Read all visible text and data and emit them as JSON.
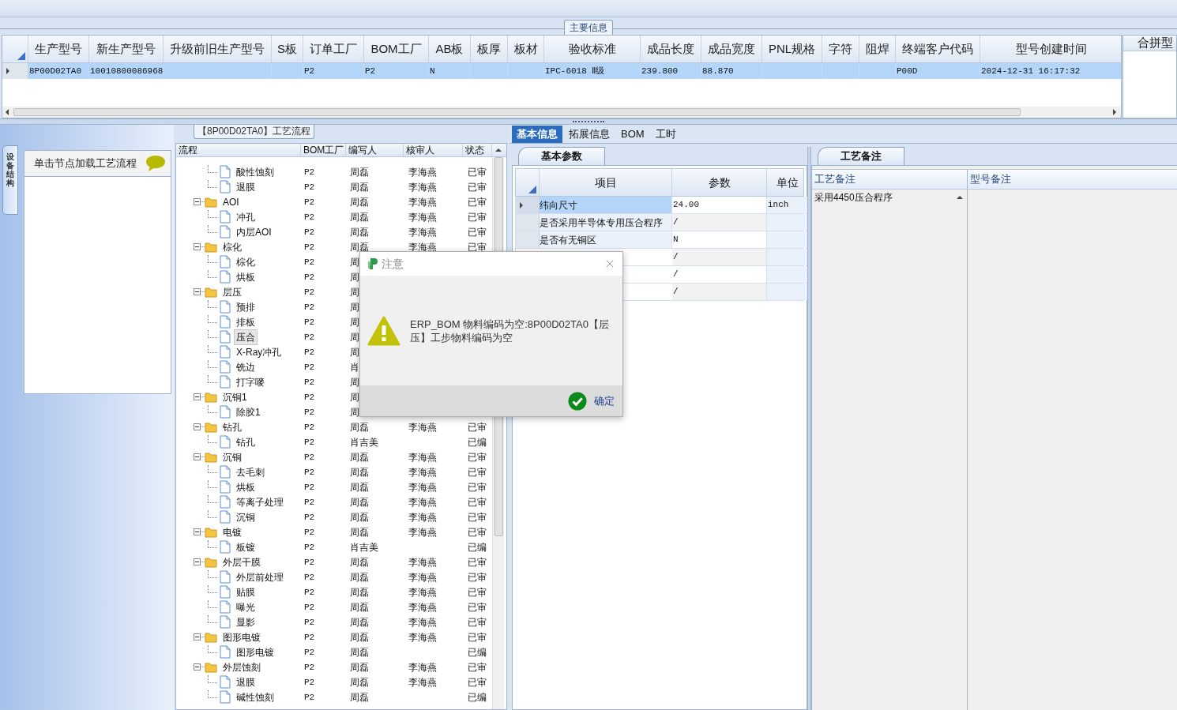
{
  "main_info": {
    "title": "主要信息",
    "columns": [
      "生产型号",
      "新生产型号",
      "升级前旧生产型号",
      "S板",
      "订单工厂",
      "BOM工厂",
      "AB板",
      "板厚",
      "板材",
      "验收标准",
      "成品长度",
      "成品宽度",
      "PNL规格",
      "字符",
      "阻焊",
      "终端客户代码",
      "型号创建时间"
    ],
    "rows": [
      {
        "selected": true,
        "cells": [
          "8P00D02TA0",
          "10010800086968",
          null,
          null,
          "P2",
          "P2",
          "N",
          null,
          null,
          "IPC-6018 Ⅱ级",
          "239.800",
          "88.870",
          null,
          null,
          null,
          "P00D",
          "2024-12-31 16:17:32"
        ]
      }
    ],
    "side_header": "合拼型"
  },
  "left_pane": {
    "side_tab": "设备结构",
    "hint": "单击节点加载工艺流程"
  },
  "process": {
    "title": "【8P00D02TA0】工艺流程",
    "columns": [
      "流程",
      "BOM工厂",
      "编写人",
      "核审人",
      "状态"
    ],
    "nodes": [
      {
        "children": [
          {
            "label": "酸性蚀刻",
            "factory": "P2",
            "writer": "周磊",
            "reviewer": "李海燕",
            "status": "已审",
            "selected": false
          },
          {
            "label": "退膜",
            "factory": "P2",
            "writer": "周磊",
            "reviewer": "李海燕",
            "status": "已审",
            "selected": false
          }
        ]
      },
      {
        "label": "AOI",
        "factory": "P2",
        "writer": "周磊",
        "reviewer": "李海燕",
        "status": "已审",
        "selected": false,
        "expanded": true,
        "children": [
          {
            "label": "冲孔",
            "factory": "P2",
            "writer": "周磊",
            "reviewer": "李海燕",
            "status": "已审",
            "selected": false
          },
          {
            "label": "内层AOI",
            "factory": "P2",
            "writer": "周磊",
            "reviewer": "李海燕",
            "status": "已审",
            "selected": false
          }
        ]
      },
      {
        "label": "棕化",
        "factory": "P2",
        "writer": "周磊",
        "reviewer": "李海燕",
        "status": "已审",
        "selected": false,
        "expanded": true,
        "children": [
          {
            "label": "棕化",
            "factory": "P2",
            "writer": "周",
            "selected": false
          },
          {
            "label": "烘板",
            "factory": "P2",
            "writer": "周",
            "selected": false
          }
        ]
      },
      {
        "label": "层压",
        "factory": "P2",
        "writer": "周",
        "selected": false,
        "expanded": true,
        "children": [
          {
            "label": "预排",
            "factory": "P2",
            "writer": "周",
            "selected": false
          },
          {
            "label": "排板",
            "factory": "P2",
            "writer": "周",
            "selected": false
          },
          {
            "label": "压合",
            "factory": "P2",
            "writer": "周",
            "selected": true
          },
          {
            "label": "X-Ray冲孔",
            "factory": "P2",
            "writer": "周",
            "selected": false
          },
          {
            "label": "铣边",
            "factory": "P2",
            "writer": "肖",
            "selected": false
          },
          {
            "label": "打字嘜",
            "factory": "P2",
            "writer": "周",
            "selected": false
          }
        ]
      },
      {
        "label": "沉铜1",
        "factory": "P2",
        "writer": "周",
        "selected": false,
        "expanded": true,
        "children": [
          {
            "label": "除胶1",
            "factory": "P2",
            "writer": "周",
            "selected": false
          }
        ]
      },
      {
        "label": "钻孔",
        "factory": "P2",
        "writer": "周磊",
        "reviewer": "李海燕",
        "status": "已审",
        "selected": false,
        "expanded": true,
        "children": [
          {
            "label": "钻孔",
            "factory": "P2",
            "writer": "肖吉美",
            "status": "已编",
            "selected": false
          }
        ]
      },
      {
        "label": "沉铜",
        "factory": "P2",
        "writer": "周磊",
        "reviewer": "李海燕",
        "status": "已审",
        "selected": false,
        "expanded": true,
        "children": [
          {
            "label": "去毛刺",
            "factory": "P2",
            "writer": "周磊",
            "reviewer": "李海燕",
            "status": "已审",
            "selected": false
          },
          {
            "label": "烘板",
            "factory": "P2",
            "writer": "周磊",
            "reviewer": "李海燕",
            "status": "已审",
            "selected": false
          },
          {
            "label": "等离子处理",
            "factory": "P2",
            "writer": "周磊",
            "reviewer": "李海燕",
            "status": "已审",
            "selected": false
          },
          {
            "label": "沉铜",
            "factory": "P2",
            "writer": "周磊",
            "reviewer": "李海燕",
            "status": "已审",
            "selected": false
          }
        ]
      },
      {
        "label": "电镀",
        "factory": "P2",
        "writer": "周磊",
        "reviewer": "李海燕",
        "status": "已审",
        "selected": false,
        "expanded": true,
        "children": [
          {
            "label": "板镀",
            "factory": "P2",
            "writer": "肖吉美",
            "status": "已编",
            "selected": false
          }
        ]
      },
      {
        "label": "外层干膜",
        "factory": "P2",
        "writer": "周磊",
        "reviewer": "李海燕",
        "status": "已审",
        "selected": false,
        "expanded": true,
        "children": [
          {
            "label": "外层前处理",
            "factory": "P2",
            "writer": "周磊",
            "reviewer": "李海燕",
            "status": "已审",
            "selected": false
          },
          {
            "label": "贴膜",
            "factory": "P2",
            "writer": "周磊",
            "reviewer": "李海燕",
            "status": "已审",
            "selected": false
          },
          {
            "label": "曝光",
            "factory": "P2",
            "writer": "周磊",
            "reviewer": "李海燕",
            "status": "已审",
            "selected": false
          },
          {
            "label": "显影",
            "factory": "P2",
            "writer": "周磊",
            "reviewer": "李海燕",
            "status": "已审",
            "selected": false
          }
        ]
      },
      {
        "label": "图形电镀",
        "factory": "P2",
        "writer": "周磊",
        "reviewer": "李海燕",
        "status": "已审",
        "selected": false,
        "expanded": true,
        "children": [
          {
            "label": "图形电镀",
            "factory": "P2",
            "writer": "周磊",
            "status": "已编",
            "selected": false
          }
        ]
      },
      {
        "label": "外层蚀刻",
        "factory": "P2",
        "writer": "周磊",
        "reviewer": "李海燕",
        "status": "已审",
        "selected": false,
        "expanded": true,
        "children": [
          {
            "label": "退膜",
            "factory": "P2",
            "writer": "周磊",
            "reviewer": "李海燕",
            "status": "已审",
            "selected": false
          },
          {
            "label": "碱性蚀刻",
            "factory": "P2",
            "writer": "周磊",
            "status": "已编",
            "selected": false
          }
        ]
      }
    ]
  },
  "detail": {
    "tabs": [
      {
        "label": "基本信息",
        "selected": true
      },
      {
        "label": "拓展信息",
        "selected": false
      },
      {
        "label": "BOM",
        "selected": false
      },
      {
        "label": "工时",
        "selected": false
      }
    ],
    "params": {
      "tab": "基本参数",
      "columns": [
        "项目",
        "参数",
        "单位"
      ],
      "rows": [
        {
          "item": "纬向尺寸",
          "value": "24.00",
          "unit": "inch",
          "selected": true
        },
        {
          "item": "是否采用半导体专用压合程序",
          "value": "/",
          "selected": false
        },
        {
          "item": "是否有无铜区",
          "value": "N",
          "selected": false
        },
        {
          "value": "/"
        },
        {
          "value": "/"
        },
        {
          "value": "/"
        }
      ]
    },
    "notes": {
      "tab": "工艺备注",
      "columns": [
        "工艺备注",
        "型号备注"
      ],
      "process_note": "采用4450压合程序"
    }
  },
  "dialog": {
    "title": "注意",
    "message": "ERP_BOM 物料编码为空:8P00D02TA0【层压】工步物料编码为空",
    "ok": "确定"
  }
}
